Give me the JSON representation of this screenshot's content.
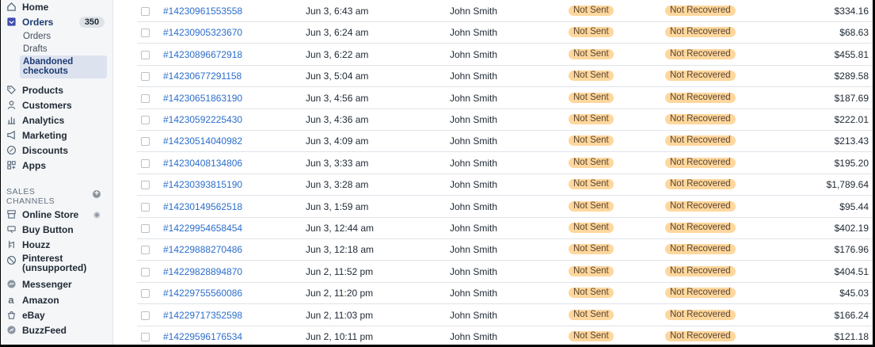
{
  "sidebar": {
    "home": "Home",
    "orders": "Orders",
    "orders_count": "350",
    "sub_orders": "Orders",
    "sub_drafts": "Drafts",
    "sub_abandoned_line1": "Abandoned",
    "sub_abandoned_line2": "checkouts",
    "products": "Products",
    "customers": "Customers",
    "analytics": "Analytics",
    "marketing": "Marketing",
    "discounts": "Discounts",
    "apps": "Apps",
    "sales_channels_line1": "SALES",
    "sales_channels_line2": "CHANNELS",
    "channels": [
      {
        "label": "Online Store",
        "icon": "store-icon"
      },
      {
        "label": "Buy Button",
        "icon": "buy-button-icon"
      },
      {
        "label": "Houzz",
        "icon": "houzz-icon"
      },
      {
        "label": "Pinterest",
        "label2": "(unsupported)",
        "icon": "blocked-icon"
      },
      {
        "label": "Messenger",
        "icon": "messenger-icon"
      },
      {
        "label": "Amazon",
        "icon": "amazon-icon"
      },
      {
        "label": "eBay",
        "icon": "ebay-icon"
      },
      {
        "label": "BuzzFeed",
        "icon": "buzzfeed-icon"
      }
    ]
  },
  "rows": [
    {
      "id": "#14230961553558",
      "date": "Jun 3, 6:43 am",
      "customer": "John Smith",
      "email": "Not Sent",
      "recovery": "Not Recovered",
      "amount": "$334.16"
    },
    {
      "id": "#14230905323670",
      "date": "Jun 3, 6:24 am",
      "customer": "John Smith",
      "email": "Not Sent",
      "recovery": "Not Recovered",
      "amount": "$68.63"
    },
    {
      "id": "#14230896672918",
      "date": "Jun 3, 6:22 am",
      "customer": "John Smith",
      "email": "Not Sent",
      "recovery": "Not Recovered",
      "amount": "$455.81"
    },
    {
      "id": "#14230677291158",
      "date": "Jun 3, 5:04 am",
      "customer": "John Smith",
      "email": "Not Sent",
      "recovery": "Not Recovered",
      "amount": "$289.58"
    },
    {
      "id": "#14230651863190",
      "date": "Jun 3, 4:56 am",
      "customer": "John Smith",
      "email": "Not Sent",
      "recovery": "Not Recovered",
      "amount": "$187.69"
    },
    {
      "id": "#14230592225430",
      "date": "Jun 3, 4:36 am",
      "customer": "John Smith",
      "email": "Not Sent",
      "recovery": "Not Recovered",
      "amount": "$222.01"
    },
    {
      "id": "#14230514040982",
      "date": "Jun 3, 4:09 am",
      "customer": "John Smith",
      "email": "Not Sent",
      "recovery": "Not Recovered",
      "amount": "$213.43"
    },
    {
      "id": "#14230408134806",
      "date": "Jun 3, 3:33 am",
      "customer": "John Smith",
      "email": "Not Sent",
      "recovery": "Not Recovered",
      "amount": "$195.20"
    },
    {
      "id": "#14230393815190",
      "date": "Jun 3, 3:28 am",
      "customer": "John Smith",
      "email": "Not Sent",
      "recovery": "Not Recovered",
      "amount": "$1,789.64"
    },
    {
      "id": "#14230149562518",
      "date": "Jun 3, 1:59 am",
      "customer": "John Smith",
      "email": "Not Sent",
      "recovery": "Not Recovered",
      "amount": "$95.44"
    },
    {
      "id": "#14229954658454",
      "date": "Jun 3, 12:44 am",
      "customer": "John Smith",
      "email": "Not Sent",
      "recovery": "Not Recovered",
      "amount": "$402.19"
    },
    {
      "id": "#14229888270486",
      "date": "Jun 3, 12:18 am",
      "customer": "John Smith",
      "email": "Not Sent",
      "recovery": "Not Recovered",
      "amount": "$176.96"
    },
    {
      "id": "#14229828894870",
      "date": "Jun 2, 11:52 pm",
      "customer": "John Smith",
      "email": "Not Sent",
      "recovery": "Not Recovered",
      "amount": "$404.51"
    },
    {
      "id": "#14229755560086",
      "date": "Jun 2, 11:20 pm",
      "customer": "John Smith",
      "email": "Not Sent",
      "recovery": "Not Recovered",
      "amount": "$45.03"
    },
    {
      "id": "#14229717352598",
      "date": "Jun 2, 11:03 pm",
      "customer": "John Smith",
      "email": "Not Sent",
      "recovery": "Not Recovered",
      "amount": "$166.24"
    },
    {
      "id": "#14229596176534",
      "date": "Jun 2, 10:11 pm",
      "customer": "John Smith",
      "email": "Not Sent",
      "recovery": "Not Recovered",
      "amount": "$121.18"
    }
  ],
  "colors": {
    "pill_bg": "#ffd79d",
    "link": "#2c6ecb",
    "sidebar_bg": "#f4f6f8",
    "active_bg": "#dde2ef"
  }
}
